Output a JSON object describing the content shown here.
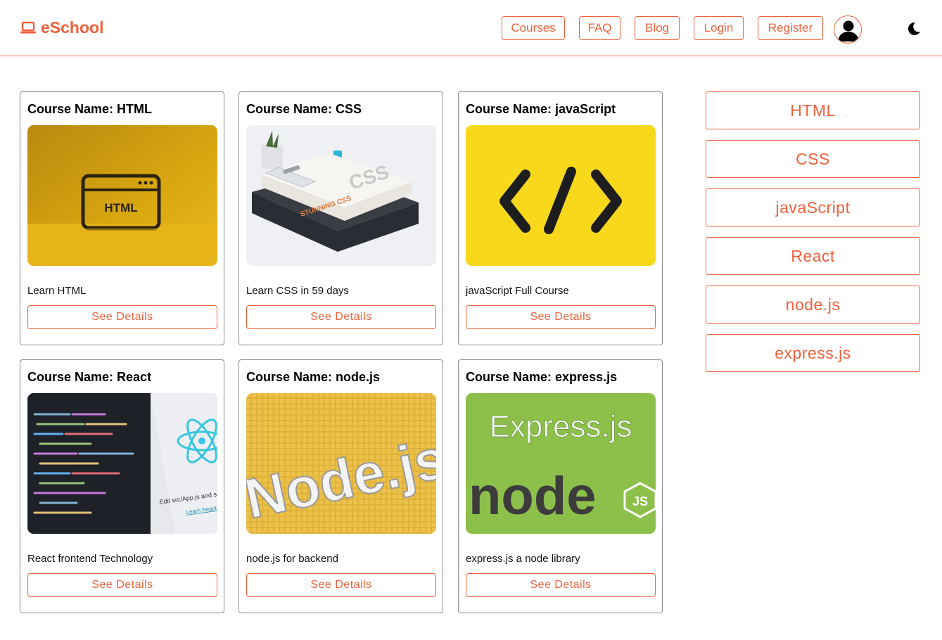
{
  "header": {
    "brand": "eSchool",
    "nav": [
      "Courses",
      "FAQ",
      "Blog",
      "Login",
      "Register"
    ]
  },
  "colors": {
    "accent": "#f0603a",
    "card_border": "#8a8a8a"
  },
  "courses": [
    {
      "title": "Course Name: HTML",
      "description": "Learn HTML",
      "button": "See Details",
      "image": "html-image"
    },
    {
      "title": "Course Name: CSS",
      "description": "Learn CSS in 59 days",
      "button": "See Details",
      "image": "css-books-image"
    },
    {
      "title": "Course Name: javaScript",
      "description": "javaScript Full Course",
      "button": "See Details",
      "image": "code-brackets-image"
    },
    {
      "title": "Course Name: React",
      "description": "React frontend Technology",
      "button": "See Details",
      "image": "react-editor-image"
    },
    {
      "title": "Course Name: node.js",
      "description": "node.js for backend",
      "button": "See Details",
      "image": "nodejs-blocks-image"
    },
    {
      "title": "Course Name: express.js",
      "description": "express.js a node library",
      "button": "See Details",
      "image": "express-node-image"
    }
  ],
  "sidebar": [
    "HTML",
    "CSS",
    "javaScript",
    "React",
    "node.js",
    "express.js"
  ],
  "images": {
    "html_text": "HTML",
    "css_cover_title": "CSS",
    "css_cover_subtitle": "STUNNING CSS",
    "react_caption": "Edit src/App.js and save",
    "react_link": "Learn React",
    "express_title": "Express.js",
    "node_word": "node",
    "node_js_badge": "JS",
    "nodejs_word": "Node.js"
  }
}
